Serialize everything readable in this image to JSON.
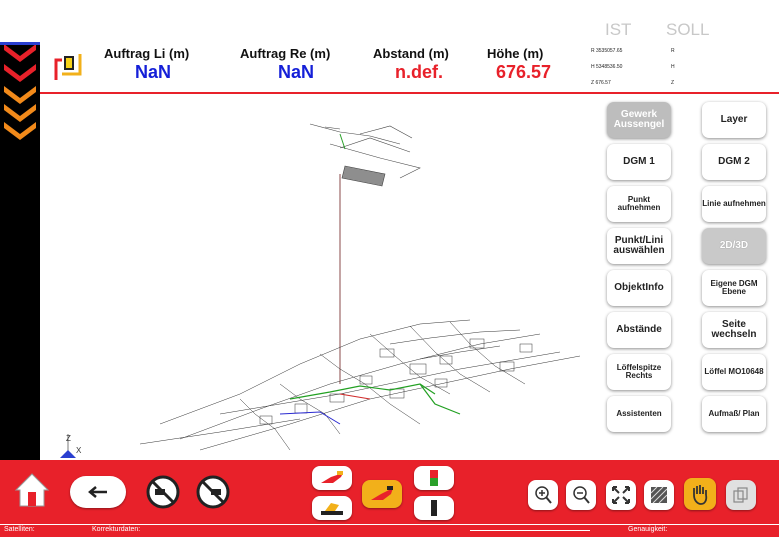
{
  "header": {
    "auftrag_li_label": "Auftrag Li (m)",
    "auftrag_li_value": "NaN",
    "auftrag_re_label": "Auftrag Re (m)",
    "auftrag_re_value": "NaN",
    "abstand_label": "Abstand (m)",
    "abstand_value": "n.def.",
    "hoehe_label": "Höhe (m)",
    "hoehe_value": "676.57",
    "ist_label": "IST",
    "soll_label": "SOLL",
    "coords": {
      "r_ist": "R 3535057.65",
      "h_ist": "H 5348536.50",
      "z_ist": "Z 676.57",
      "r_soll": "R",
      "h_soll": "H",
      "z_soll": "Z"
    }
  },
  "panel": {
    "gewerk": "Gewerk Aussengel",
    "layer": "Layer",
    "dgm1": "DGM 1",
    "dgm2": "DGM 2",
    "punkt_aufnehmen": "Punkt aufnehmen",
    "linie_aufnehmen": "Linie aufnehmen",
    "punkt_linie_auswaehlen": "Punkt/Lini auswählen",
    "mode_2d3d": "2D/3D",
    "objektinfo": "ObjektInfo",
    "eigene_dgm": "Eigene DGM Ebene",
    "abstaende": "Abstände",
    "seite_wechseln": "Seite wechseln",
    "loeffelspitze": "Löffelspitze Rechts",
    "loeffel": "Löffel MO10648",
    "assistenten": "Assistenten",
    "aufmass": "Aufmaß/ Plan"
  },
  "status": {
    "satelliten": "Satelliten:",
    "korrekturdaten": "Korrekturdaten:",
    "genauigkeit": "Genauigkeit:"
  },
  "map": {
    "axis_z": "Z",
    "axis_x": "X"
  },
  "colors": {
    "accent_red": "#e8212a",
    "value_blue": "#1520d8",
    "chevron_orange": "#f28a1a"
  }
}
